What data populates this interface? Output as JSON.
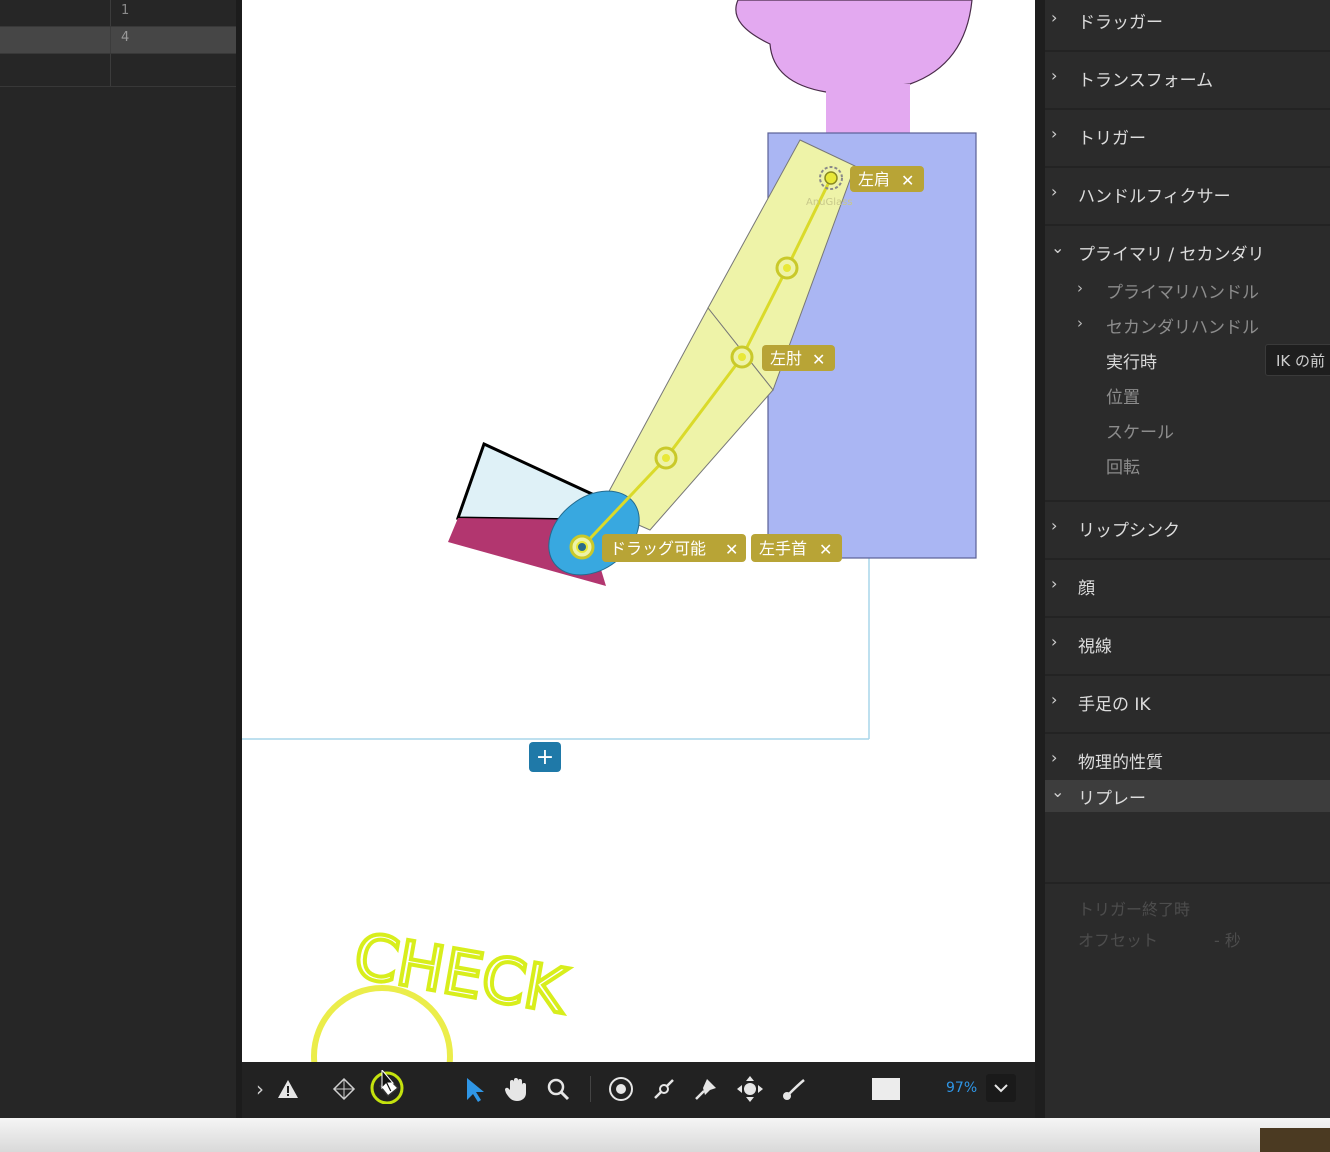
{
  "layers": {
    "rows": [
      "1",
      "4"
    ]
  },
  "stage": {
    "handle_tags": {
      "left_shoulder": "左肩",
      "left_elbow": "左肘",
      "draggable": "ドラッグ可能",
      "left_wrist": "左手首"
    },
    "handle_watermark": "AnuGlass",
    "add_button": "+",
    "annotation_text": "CHECK"
  },
  "toolbar": {
    "expand": "›",
    "zoom": "97%",
    "icons": [
      "chevron-right-icon",
      "warning-icon",
      "mesh-icon",
      "handle-tool-icon",
      "select-arrow-icon",
      "hand-icon",
      "zoom-magnifier-icon",
      "origin-tool-icon",
      "stick-tool-icon",
      "pin-tool-icon",
      "move-handle-icon",
      "draggable-tool-icon",
      "frame-preview-icon",
      "chevron-down-icon"
    ]
  },
  "properties": {
    "sections": [
      {
        "label": "ドラッガー",
        "chev": "›"
      },
      {
        "label": "トランスフォーム",
        "chev": "›"
      },
      {
        "label": "トリガー",
        "chev": "›"
      },
      {
        "label": "ハンドルフィクサー",
        "chev": "›"
      },
      {
        "label": "プライマリ / セカンダリ",
        "chev": "⌄"
      },
      {
        "label": "リップシンク",
        "chev": "›"
      },
      {
        "label": "顔",
        "chev": "›"
      },
      {
        "label": "視線",
        "chev": "›"
      },
      {
        "label": "手足の IK",
        "chev": "›"
      },
      {
        "label": "物理的性質",
        "chev": "›"
      },
      {
        "label": "リプレー",
        "chev": "⌄"
      }
    ],
    "primary_secondary": {
      "primary_handle": "プライマリハンドル",
      "secondary_handle": "セカンダリハンドル",
      "when_running": "実行時",
      "when_running_value": "IK の前",
      "position": "位置",
      "scale": "スケール",
      "rotation": "回転"
    },
    "replay": {
      "trigger_end": "トリガー終了時",
      "offset": "オフセット",
      "offset_value": "- 秒"
    }
  },
  "colors": {
    "head": "#e3a9f0",
    "body": "#aab6f3",
    "arm": "#eef3a8",
    "hand": "#38a8e0",
    "handle": "#e8e838",
    "tag": "#b8a436",
    "annotation": "#d8ee1c",
    "zoom": "#2f96e6"
  }
}
